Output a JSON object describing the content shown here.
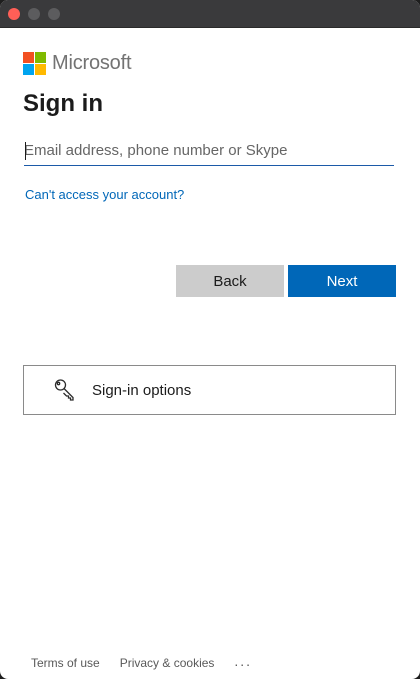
{
  "window": {
    "traffic_colors": {
      "close": "#ff5f57",
      "inactive": "#5c5c5e"
    }
  },
  "brand": {
    "name": "Microsoft",
    "logo_colors": [
      "#f25022",
      "#7fba00",
      "#00a4ef",
      "#ffb900"
    ]
  },
  "page": {
    "title": "Sign in"
  },
  "email": {
    "placeholder": "Email address, phone number or Skype",
    "value": ""
  },
  "links": {
    "cant_access": "Can't access your account?"
  },
  "buttons": {
    "back": "Back",
    "next": "Next"
  },
  "options": {
    "icon": "key-icon",
    "label": "Sign-in options"
  },
  "footer": {
    "terms": "Terms of use",
    "privacy": "Privacy & cookies",
    "more": "..."
  },
  "colors": {
    "accent": "#0067b8",
    "secondary_button": "#cccccc",
    "text": "#1b1b1b"
  }
}
